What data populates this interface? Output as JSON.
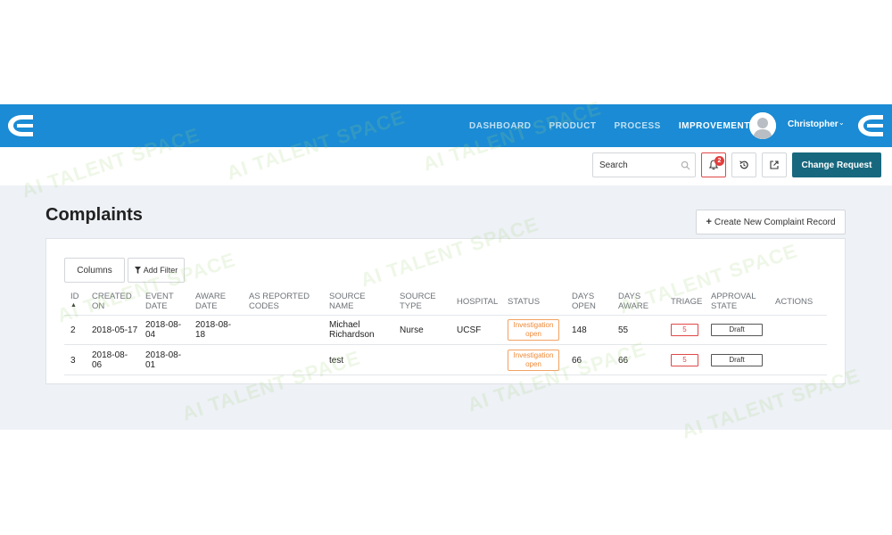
{
  "nav": {
    "links": [
      "DASHBOARD",
      "PRODUCT",
      "PROCESS",
      "IMPROVEMENT"
    ],
    "active": "IMPROVEMENT",
    "user_name": "Christopher",
    "brand_color": "#1a8bd4"
  },
  "toolbar": {
    "search_placeholder": "Search",
    "notification_count": "2",
    "change_request_label": "Change Request",
    "change_request_color": "#17687e"
  },
  "page": {
    "title": "Complaints",
    "create_label": "Create New Complaint Record",
    "columns_label": "Columns",
    "add_filter_label": "Add Filter"
  },
  "table": {
    "headers": [
      [
        "ID"
      ],
      [
        "CREATED",
        "ON"
      ],
      [
        "EVENT",
        "DATE"
      ],
      [
        "AWARE",
        "DATE"
      ],
      [
        "AS REPORTED",
        "CODES"
      ],
      [
        "SOURCE",
        "NAME"
      ],
      [
        "SOURCE",
        "TYPE"
      ],
      [
        "HOSPITAL"
      ],
      [
        "STATUS"
      ],
      [
        "DAYS",
        "OPEN"
      ],
      [
        "DAYS",
        "AWARE"
      ],
      [
        "TRIAGE"
      ],
      [
        "APPROVAL",
        "STATE"
      ],
      [
        "ACTIONS"
      ]
    ],
    "rows": [
      {
        "id": "2",
        "created": [
          "2018-05-17"
        ],
        "event": [
          "2018-08-",
          "04"
        ],
        "aware": [
          "2018-08-",
          "18"
        ],
        "codes": "",
        "source_name": [
          "Michael",
          "Richardson"
        ],
        "source_type": "Nurse",
        "hospital": "UCSF",
        "status": [
          "Investigation",
          "open"
        ],
        "days_open": "148",
        "days_aware": "55",
        "triage": "5",
        "approval": "Draft"
      },
      {
        "id": "3",
        "created": [
          "2018-08-",
          "06"
        ],
        "event": [
          "2018-08-",
          "01"
        ],
        "aware": [],
        "codes": "",
        "source_name": [
          "test"
        ],
        "source_type": "",
        "hospital": "",
        "status": [
          "Investigation",
          "open"
        ],
        "days_open": "66",
        "days_aware": "66",
        "triage": "5",
        "approval": "Draft"
      }
    ]
  },
  "watermark": "AI TALENT SPACE",
  "colors": {
    "status": "#f08a3a",
    "triage": "#e04848",
    "background": "#eef1f6"
  }
}
